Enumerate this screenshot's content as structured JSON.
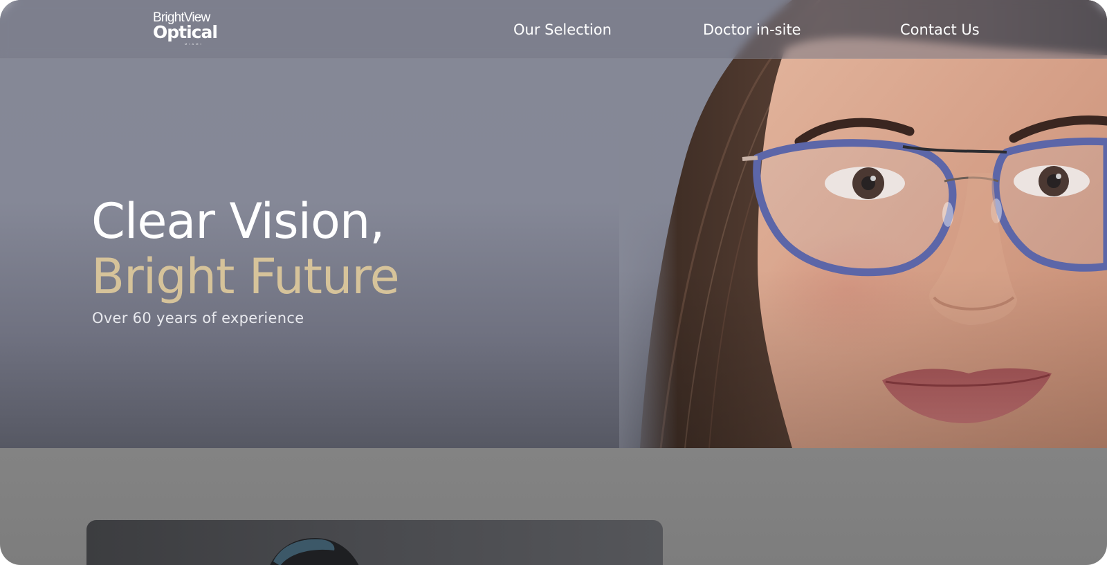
{
  "brand": {
    "top": "BrightView",
    "main": "Optical",
    "sub": "MIAMI"
  },
  "nav": {
    "items": [
      {
        "label": "Our Selection"
      },
      {
        "label": "Doctor in-site"
      },
      {
        "label": "Contact Us"
      }
    ]
  },
  "hero": {
    "headline_line1": "Clear Vision,",
    "headline_line2": "Bright Future",
    "tagline": "Over 60 years of experience"
  },
  "colors": {
    "hero_background": "#858896",
    "accent_gold": "#d6c39a",
    "glasses_frame": "#5c66a8"
  }
}
